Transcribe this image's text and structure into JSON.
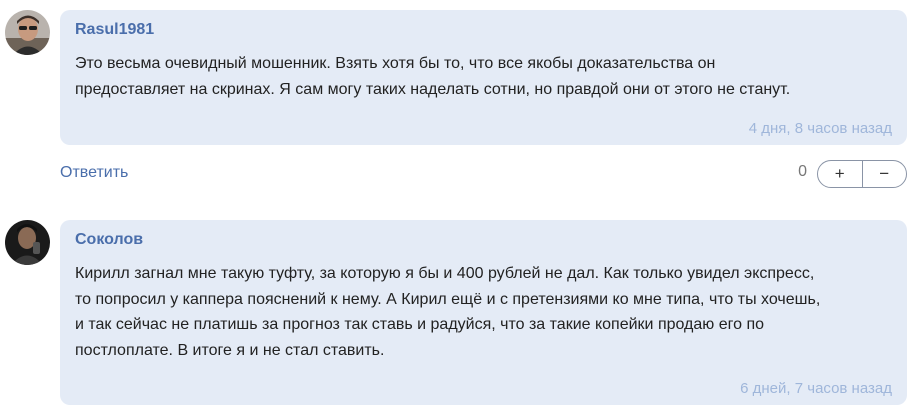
{
  "comments": [
    {
      "author": "Rasul1981",
      "text_lines": [
        "Это весьма очевидный мошенник. Взять хотя бы то, что все якобы доказательства он",
        "предоставляет на скринах. Я сам могу таких наделать сотни, но правдой они от этого не станут."
      ],
      "time": "4 дня, 8 часов назад",
      "avatar_icon": "user-photo-icon"
    },
    {
      "author": "Соколов",
      "text_lines": [
        "Кирилл загнал мне такую туфту, за которую я бы и 400 рублей не дал. Как только увидел экспресс,",
        "то попросил у каппера пояснений к нему. А Кирил ещё и с претензиями ко мне типа, что ты хочешь,",
        "и так сейчас не платишь за прогноз так ставь и радуйся, что за такие копейки продаю его по",
        "постлоплате. В итоге я и не стал ставить."
      ],
      "time": "6 дней, 7 часов назад",
      "avatar_icon": "user-photo-icon"
    }
  ],
  "actions": {
    "reply_label": "Ответить",
    "score": "0",
    "upvote_label": "+",
    "downvote_label": "−"
  },
  "colors": {
    "bubble": "#e4ebf6",
    "author": "#4a6eab",
    "time": "#9fb6da"
  }
}
